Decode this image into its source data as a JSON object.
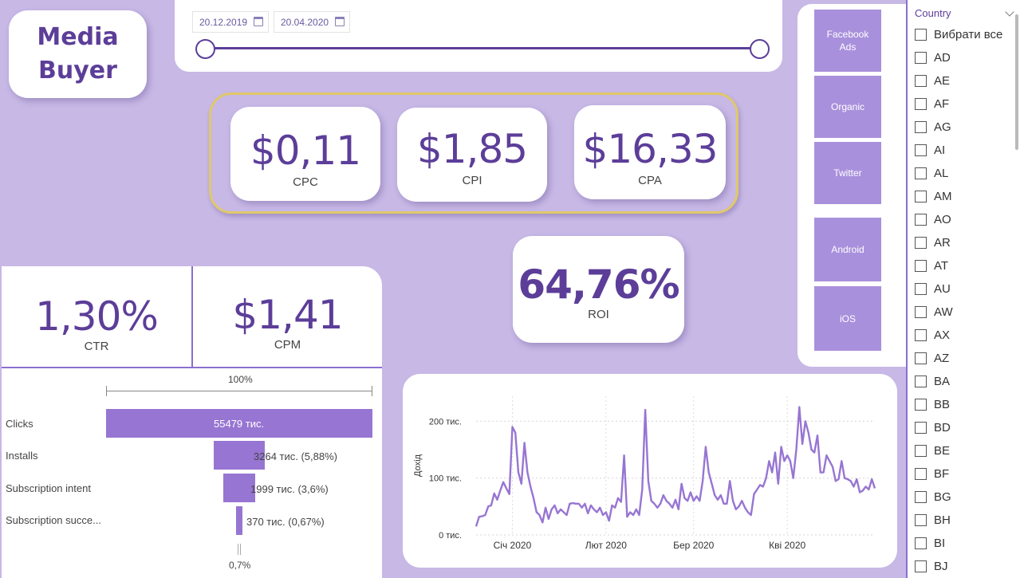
{
  "title": "Media\nBuyer",
  "date_range": {
    "start": "20.12.2019",
    "end": "20.04.2020"
  },
  "kpis": [
    {
      "value": "$0,11",
      "label": "CPC"
    },
    {
      "value": "$1,85",
      "label": "CPI"
    },
    {
      "value": "$16,33",
      "label": "CPA"
    }
  ],
  "roi": {
    "value": "64,76%",
    "label": "ROI"
  },
  "ctr": {
    "value": "1,30%",
    "label": "CTR"
  },
  "cpm": {
    "value": "$1,41",
    "label": "CPM"
  },
  "sources": [
    "Facebook Ads",
    "Organic",
    "Twitter",
    "Android",
    "iOS"
  ],
  "funnel": {
    "top_label": "100%",
    "bottom_label": "0,7%",
    "stages": [
      {
        "label": "Clicks",
        "value_label": "55479 тис.",
        "pct": 100
      },
      {
        "label": "Installs",
        "value_label": "3264 тис. (5,88%)",
        "pct": 5.88
      },
      {
        "label": "Subscription intent",
        "value_label": "1999 тис. (3,6%)",
        "pct": 3.6
      },
      {
        "label": "Subscription succe...",
        "value_label": "370 тис. (0,67%)",
        "pct": 0.67
      }
    ]
  },
  "country": {
    "header": "Country",
    "items": [
      "Вибрати все",
      "AD",
      "AE",
      "AF",
      "AG",
      "AI",
      "AL",
      "AM",
      "AO",
      "AR",
      "AT",
      "AU",
      "AW",
      "AX",
      "AZ",
      "BA",
      "BB",
      "BD",
      "BE",
      "BF",
      "BG",
      "BH",
      "BI",
      "BJ"
    ]
  },
  "colors": {
    "accent": "#5c3e99",
    "bar": "#9775d2",
    "line": "#9775d2",
    "background": "#c7b8e6",
    "kpi_border": "#e0c86a"
  },
  "chart_data": {
    "type": "line",
    "ylabel": "Дохід",
    "xlabel": "",
    "ylim": [
      0,
      230
    ],
    "y_ticks": [
      {
        "value": 0,
        "label": "0 тис."
      },
      {
        "value": 100,
        "label": "100 тис."
      },
      {
        "value": 200,
        "label": "200 тис."
      }
    ],
    "x_ticks": [
      {
        "index": 12,
        "label": "Січ 2020"
      },
      {
        "index": 43,
        "label": "Лют 2020"
      },
      {
        "index": 72,
        "label": "Бер 2020"
      },
      {
        "index": 103,
        "label": "Кві 2020"
      }
    ],
    "grid": true,
    "series": [
      {
        "values": [
          15,
          32,
          33,
          35,
          50,
          52,
          73,
          62,
          78,
          93,
          82,
          72,
          190,
          180,
          110,
          90,
          162,
          110,
          85,
          65,
          40,
          35,
          22,
          48,
          28,
          45,
          52,
          38,
          45,
          40,
          35,
          55,
          56,
          55,
          55,
          48,
          55,
          38,
          52,
          45,
          40,
          48,
          35,
          40,
          25,
          52,
          48,
          65,
          58,
          140,
          32,
          40,
          35,
          45,
          35,
          80,
          220,
          95,
          60,
          55,
          48,
          55,
          70,
          60,
          55,
          48,
          62,
          45,
          90,
          65,
          60,
          75,
          60,
          68,
          60,
          95,
          155,
          110,
          90,
          70,
          62,
          70,
          55,
          55,
          95,
          60,
          45,
          50,
          60,
          48,
          40,
          35,
          72,
          80,
          88,
          85,
          100,
          130,
          110,
          145,
          90,
          155,
          130,
          140,
          130,
          100,
          150,
          225,
          160,
          200,
          180,
          150,
          145,
          175,
          110,
          110,
          140,
          130,
          120,
          95,
          98,
          130,
          100,
          98,
          95,
          85,
          98,
          75,
          78,
          85,
          80,
          98,
          82
        ]
      }
    ]
  }
}
